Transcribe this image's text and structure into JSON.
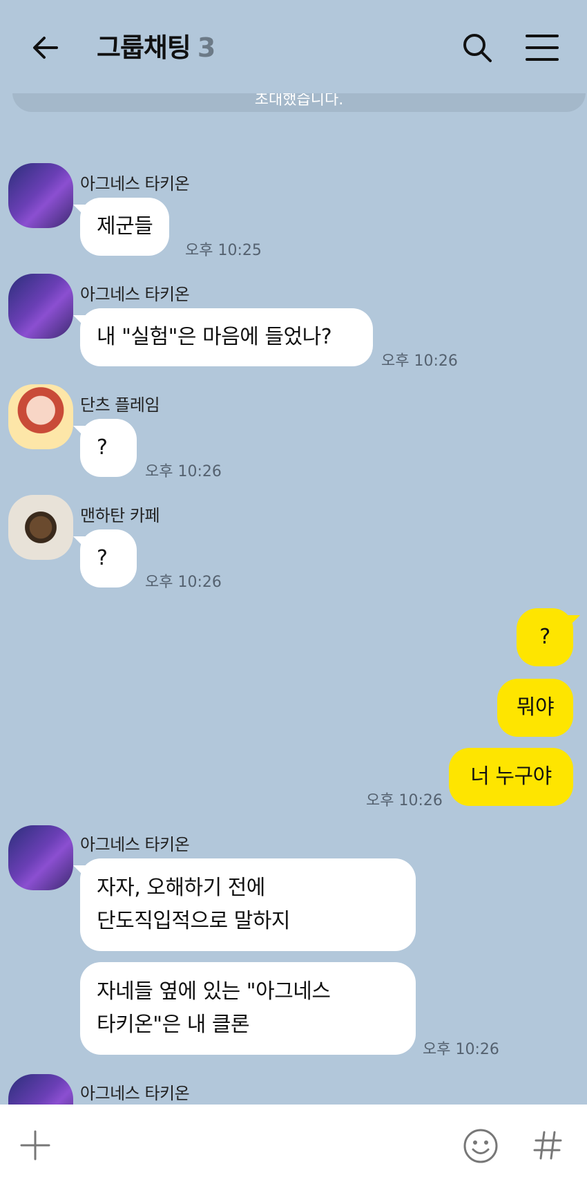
{
  "header": {
    "back_icon": "arrow-left-icon",
    "title": "그룹채팅",
    "member_count": "3",
    "search_icon": "search-icon",
    "menu_icon": "hamburger-menu-icon"
  },
  "notice": {
    "text": "초대했습니다."
  },
  "messages": [
    {
      "sender": "아그네스 타키온",
      "text": "제군들",
      "time": "오후 10:25"
    },
    {
      "sender": "아그네스 타키온",
      "text": "내 \"실험\"은 마음에 들었나?",
      "time": "오후 10:26"
    },
    {
      "sender": "단츠 플레임",
      "text": "?",
      "time": "오후 10:26"
    },
    {
      "sender": "맨하탄 카페",
      "text": "?",
      "time": "오후 10:26"
    }
  ],
  "my_messages": [
    {
      "text": "?"
    },
    {
      "text": "뭐야"
    },
    {
      "text": "너 누구야",
      "time": "오후 10:26"
    }
  ],
  "agnes_group": {
    "sender": "아그네스 타키온",
    "bubble1_line1": "자자, 오해하기 전에",
    "bubble1_line2": "단도직입적으로 말하지",
    "bubble2_line1": "자네들 옆에 있는 \"아그네스",
    "bubble2_line2": "타키온\"은 내 클론",
    "time": "오후 10:26"
  },
  "last_sender": "아그네스 타키온",
  "footer": {
    "plus_icon": "plus-icon",
    "emoji_icon": "emoji-icon",
    "hash_icon": "hash-icon"
  },
  "colors": {
    "background": "#b2c7da",
    "my_bubble": "#fee500",
    "other_bubble": "#ffffff"
  }
}
